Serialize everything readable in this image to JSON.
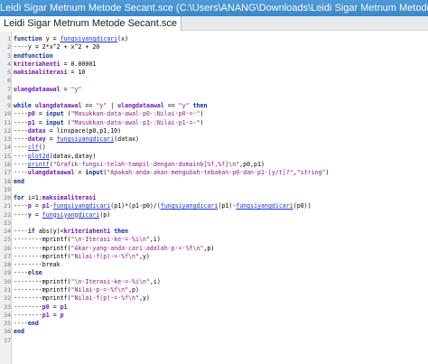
{
  "window": {
    "title": "Leidi Sigar Metnum Metode Secant.sce (C:\\Users\\ANANG\\Downloads\\Leidi Sigar Metnum Metode Secant.sce) - SciNotes"
  },
  "tabs": [
    {
      "label": "Leidi Sigar Metnum Metode Secant.sce"
    }
  ],
  "editor": {
    "lines": [
      {
        "n": "1",
        "tokens": [
          [
            "kw",
            "function "
          ],
          [
            "t",
            "y = "
          ],
          [
            "fn",
            "fungsiyangdicari"
          ],
          [
            "t",
            "(x)"
          ]
        ]
      },
      {
        "n": "2",
        "tokens": [
          [
            "t",
            "····y = 2*x^2 + x^2 + 20"
          ]
        ]
      },
      {
        "n": "3",
        "tokens": [
          [
            "kw",
            "endfunction"
          ]
        ]
      },
      {
        "n": "4",
        "tokens": [
          [
            "var",
            "kriteriahenti"
          ],
          [
            "t",
            " = 0.00001"
          ]
        ]
      },
      {
        "n": "5",
        "tokens": [
          [
            "var",
            "maksimaliterasi"
          ],
          [
            "t",
            " = 10"
          ]
        ]
      },
      {
        "n": "6",
        "tokens": []
      },
      {
        "n": "7",
        "tokens": [
          [
            "var",
            "ulangdataawal"
          ],
          [
            "t",
            " = "
          ],
          [
            "str",
            "\"y\""
          ]
        ]
      },
      {
        "n": "8",
        "tokens": []
      },
      {
        "n": "9",
        "tokens": [
          [
            "kw",
            "while "
          ],
          [
            "var",
            "ulangdataawal"
          ],
          [
            "t",
            " == "
          ],
          [
            "str",
            "\"y\""
          ],
          [
            "t",
            " | "
          ],
          [
            "var",
            "ulangdataawal"
          ],
          [
            "t",
            " == "
          ],
          [
            "str",
            "\"y\""
          ],
          [
            "kw",
            " then"
          ]
        ]
      },
      {
        "n": "10",
        "tokens": [
          [
            "t",
            "····"
          ],
          [
            "var",
            "p0"
          ],
          [
            "t",
            " = "
          ],
          [
            "kw",
            "input"
          ],
          [
            "t",
            " ("
          ],
          [
            "str",
            "\"Masukkan·data·awal·p0·:Nilai·p0·=·\""
          ],
          [
            "t",
            ")"
          ]
        ]
      },
      {
        "n": "11",
        "tokens": [
          [
            "t",
            "····"
          ],
          [
            "var",
            "p1"
          ],
          [
            "t",
            " = "
          ],
          [
            "kw",
            "input"
          ],
          [
            "t",
            " ("
          ],
          [
            "str",
            "\"Masukkan·data·awal·p1·:Nilai·p1·=·\""
          ],
          [
            "t",
            ")"
          ]
        ]
      },
      {
        "n": "12",
        "tokens": [
          [
            "t",
            "····"
          ],
          [
            "var",
            "datax"
          ],
          [
            "t",
            " = linspace(p0,p1,10)"
          ]
        ]
      },
      {
        "n": "13",
        "tokens": [
          [
            "t",
            "····"
          ],
          [
            "var",
            "datay"
          ],
          [
            "t",
            " = "
          ],
          [
            "fn",
            "fungsiyangdicari"
          ],
          [
            "t",
            "(datax)"
          ]
        ]
      },
      {
        "n": "14",
        "tokens": [
          [
            "t",
            "····"
          ],
          [
            "fn",
            "clf"
          ],
          [
            "t",
            "()"
          ]
        ]
      },
      {
        "n": "15",
        "tokens": [
          [
            "t",
            "····"
          ],
          [
            "fn",
            "plot2d"
          ],
          [
            "t",
            "(datax,datay)"
          ]
        ]
      },
      {
        "n": "16",
        "tokens": [
          [
            "t",
            "····"
          ],
          [
            "fn",
            "printf"
          ],
          [
            "t",
            "("
          ],
          [
            "str",
            "\"Grafik·fungsi·telah·tampil·dengan·domainb[%f,%f]\\n\""
          ],
          [
            "t",
            ",p0,p1)"
          ]
        ]
      },
      {
        "n": "17",
        "tokens": [
          [
            "t",
            "····"
          ],
          [
            "var",
            "ulangdataawal"
          ],
          [
            "t",
            " = "
          ],
          [
            "kw",
            "input"
          ],
          [
            "t",
            "("
          ],
          [
            "str",
            "\"Apakah·anda·akan·mengubah·tebakan·p0·dan·p1·[y/t]?\""
          ],
          [
            "t",
            ","
          ],
          [
            "str",
            "\"string\""
          ],
          [
            "t",
            ")"
          ]
        ]
      },
      {
        "n": "18",
        "tokens": [
          [
            "kw",
            "end"
          ]
        ]
      },
      {
        "n": "19",
        "tokens": []
      },
      {
        "n": "20",
        "tokens": [
          [
            "kw",
            "for "
          ],
          [
            "t",
            "i=1:"
          ],
          [
            "var",
            "maksimaliterasi"
          ]
        ]
      },
      {
        "n": "21",
        "tokens": [
          [
            "t",
            "····"
          ],
          [
            "var",
            "p"
          ],
          [
            "t",
            " = "
          ],
          [
            "var",
            "p1"
          ],
          [
            "t",
            "-"
          ],
          [
            "fn",
            "fungsiyangdicari"
          ],
          [
            "t",
            "(p1)*(p1-p0)/("
          ],
          [
            "fn",
            "fungsiyangdicari"
          ],
          [
            "t",
            "(p1)-"
          ],
          [
            "fn",
            "fungsiyangdicari"
          ],
          [
            "t",
            "(p0))"
          ]
        ]
      },
      {
        "n": "22",
        "tokens": [
          [
            "t",
            "····"
          ],
          [
            "var",
            "y"
          ],
          [
            "t",
            " = "
          ],
          [
            "fn",
            "fungsiyangdicari"
          ],
          [
            "t",
            "(p)"
          ]
        ]
      },
      {
        "n": "23",
        "tokens": []
      },
      {
        "n": "24",
        "tokens": [
          [
            "t",
            "····"
          ],
          [
            "kw",
            "if "
          ],
          [
            "t",
            "abs(y)<"
          ],
          [
            "var",
            "kriteriahenti"
          ],
          [
            "kw",
            " then"
          ]
        ]
      },
      {
        "n": "25",
        "tokens": [
          [
            "t",
            "········mprintf("
          ],
          [
            "str",
            "\"\\n·Iterasi·ke·=·%i\\n\""
          ],
          [
            "t",
            ",i)"
          ]
        ]
      },
      {
        "n": "26",
        "tokens": [
          [
            "t",
            "········mprintf("
          ],
          [
            "str",
            "\"Akar·yang·anda·cari·adalah·p·=·%f\\n\""
          ],
          [
            "t",
            ",p)"
          ]
        ]
      },
      {
        "n": "27",
        "tokens": [
          [
            "t",
            "········mprintf("
          ],
          [
            "str",
            "\"Nilai·f(p)·=·%f\\n\""
          ],
          [
            "t",
            ",y)"
          ]
        ]
      },
      {
        "n": "28",
        "tokens": [
          [
            "t",
            "········break"
          ]
        ]
      },
      {
        "n": "29",
        "tokens": [
          [
            "t",
            "····"
          ],
          [
            "kw",
            "else"
          ]
        ]
      },
      {
        "n": "30",
        "tokens": [
          [
            "t",
            "········mprintf("
          ],
          [
            "str",
            "\"\\n·Iterasi·ke·=·%i\\n\""
          ],
          [
            "t",
            ",i)"
          ]
        ]
      },
      {
        "n": "31",
        "tokens": [
          [
            "t",
            "········mprintf("
          ],
          [
            "str",
            "\"Nilai·p·=·%f\\n\""
          ],
          [
            "t",
            ",p)"
          ]
        ]
      },
      {
        "n": "32",
        "tokens": [
          [
            "t",
            "········mprintf("
          ],
          [
            "str",
            "\"Nilai·f(p)·=·%f\\n\""
          ],
          [
            "t",
            ",y)"
          ]
        ]
      },
      {
        "n": "33",
        "tokens": [
          [
            "t",
            "········"
          ],
          [
            "var",
            "p0"
          ],
          [
            "t",
            " = "
          ],
          [
            "var",
            "p1"
          ]
        ]
      },
      {
        "n": "34",
        "tokens": [
          [
            "t",
            "········"
          ],
          [
            "var",
            "p1"
          ],
          [
            "t",
            " = "
          ],
          [
            "var",
            "p"
          ]
        ]
      },
      {
        "n": "35",
        "tokens": [
          [
            "t",
            "····"
          ],
          [
            "kw",
            "end"
          ]
        ]
      },
      {
        "n": "36",
        "tokens": [
          [
            "kw",
            "end"
          ]
        ]
      },
      {
        "n": "37",
        "tokens": []
      }
    ]
  }
}
